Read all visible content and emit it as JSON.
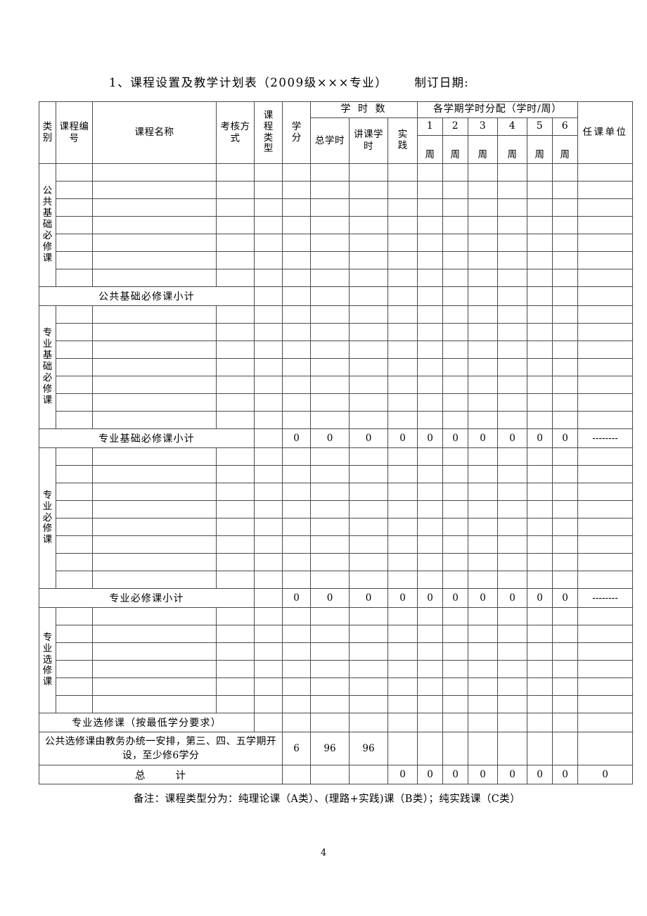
{
  "document": {
    "title_main": "1、课程设置及教学计划表（2009级×××专业）",
    "title_date_label": "制订日期:",
    "page_number": "4",
    "footnote": "备注：课程类型分为：纯理论课（A类）、(理路+实践)课（B类）；纯实践课（C类）"
  },
  "table": {
    "headers": {
      "category": "类别",
      "course_code": "课程编号",
      "course_name": "课程名称",
      "assessment": "考核方式",
      "course_type": "课程类型",
      "credits": "学分",
      "hours_group": "学 时 数",
      "total_hours": "总学时",
      "lecture_hours": "讲课学时",
      "practice_hours": "实践",
      "semester_group": "各学期学时分配（学时/周）",
      "semesters": [
        "1",
        "2",
        "3",
        "4",
        "5",
        "6"
      ],
      "week_unit": "周",
      "teaching_unit": "任课单位"
    },
    "groups": [
      {
        "category": "公共基础必修课",
        "rows": 7,
        "subtotal_label": "公共基础必修课小计",
        "subtotal_values": {
          "credits": "",
          "total_hours": "",
          "lecture_hours": "",
          "practice_hours": "",
          "semesters": [
            "",
            "",
            "",
            "",
            "",
            ""
          ],
          "teaching_unit": ""
        }
      },
      {
        "category": "专业基础必修课",
        "rows": 7,
        "subtotal_label": "专业基础必修课小计",
        "subtotal_values": {
          "credits": "0",
          "total_hours": "0",
          "lecture_hours": "0",
          "practice_hours": "0",
          "semesters": [
            "0",
            "0",
            "0",
            "0",
            "0",
            "0"
          ],
          "teaching_unit": "--------"
        }
      },
      {
        "category": "专业必修课",
        "rows": 8,
        "subtotal_label": "专业必修课小计",
        "subtotal_values": {
          "credits": "0",
          "total_hours": "0",
          "lecture_hours": "0",
          "practice_hours": "0",
          "semesters": [
            "0",
            "0",
            "0",
            "0",
            "0",
            "0"
          ],
          "teaching_unit": "--------"
        }
      },
      {
        "category": "专业选修课",
        "rows": 6,
        "subtotal_label": "专业选修课（按最低学分要求）",
        "subtotal_values": {
          "credits": "",
          "total_hours": "",
          "lecture_hours": "",
          "practice_hours": "",
          "semesters": [
            "",
            "",
            "",
            "",
            "",
            ""
          ],
          "teaching_unit": ""
        }
      }
    ],
    "public_elective": {
      "text": "公共选修课由教务办统一安排，第三、四、五学期开设，至少修6学分",
      "credits": "6",
      "total_hours": "96",
      "lecture_hours": "96",
      "practice_hours": "",
      "semesters": [
        "",
        "",
        "",
        "",
        "",
        ""
      ],
      "teaching_unit": ""
    },
    "grand_total": {
      "label_part1": "总",
      "label_part2": "计",
      "credits": "",
      "total_hours": "",
      "lecture_hours": "",
      "practice_hours": "0",
      "semesters": [
        "0",
        "0",
        "0",
        "0",
        "0",
        "0"
      ],
      "teaching_unit": "0"
    }
  }
}
